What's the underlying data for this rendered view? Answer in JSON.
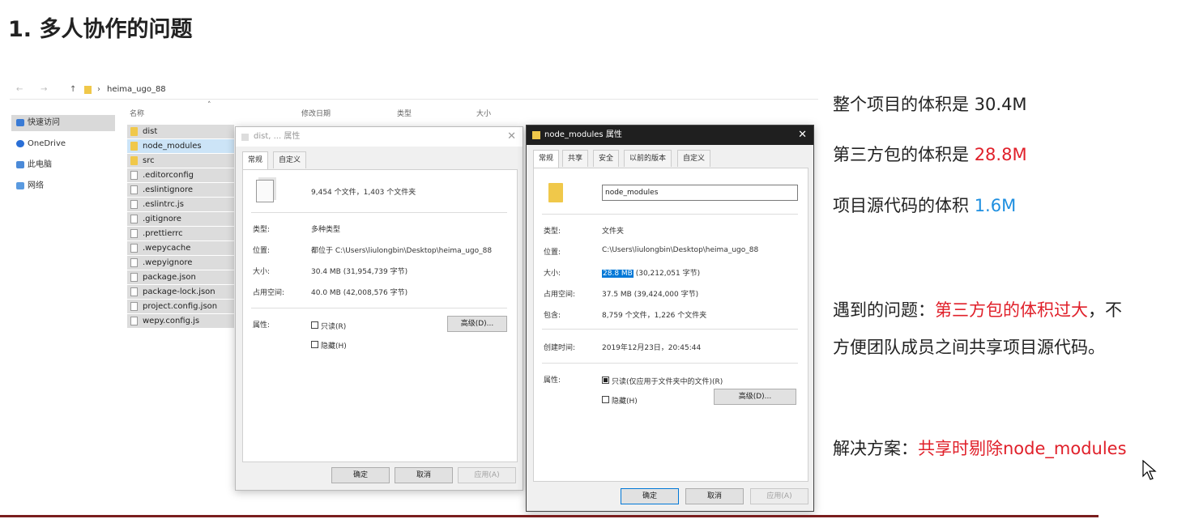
{
  "slide": {
    "title": "1. 多人协作的问题"
  },
  "explorer": {
    "path": "heima_ugo_88",
    "columns": {
      "name": "名称",
      "modified": "修改日期",
      "type": "类型",
      "size": "大小"
    },
    "nav_items": [
      "快速访问",
      "OneDrive",
      "此电脑",
      "网络"
    ],
    "files": [
      {
        "name": "dist",
        "kind": "folder"
      },
      {
        "name": "node_modules",
        "kind": "folder"
      },
      {
        "name": "src",
        "kind": "folder"
      },
      {
        "name": ".editorconfig",
        "kind": "file"
      },
      {
        "name": ".eslintignore",
        "kind": "file"
      },
      {
        "name": ".eslintrc.js",
        "kind": "file"
      },
      {
        "name": ".gitignore",
        "kind": "file"
      },
      {
        "name": ".prettierrc",
        "kind": "file"
      },
      {
        "name": ".wepycache",
        "kind": "file"
      },
      {
        "name": ".wepyignore",
        "kind": "file"
      },
      {
        "name": "package.json",
        "kind": "file"
      },
      {
        "name": "package-lock.json",
        "kind": "file"
      },
      {
        "name": "project.config.json",
        "kind": "file"
      },
      {
        "name": "wepy.config.js",
        "kind": "file"
      }
    ]
  },
  "dialog_dist": {
    "title": "dist, ... 属性",
    "tabs": [
      "常规",
      "自定义"
    ],
    "summary": "9,454 个文件，1,403 个文件夹",
    "type_label": "类型:",
    "type_value": "多种类型",
    "location_label": "位置:",
    "location_value": "都位于 C:\\Users\\liulongbin\\Desktop\\heima_ugo_88",
    "size_label": "大小:",
    "size_value": "30.4 MB (31,954,739 字节)",
    "disk_label": "占用空间:",
    "disk_value": "40.0 MB (42,008,576 字节)",
    "attr_label": "属性:",
    "readonly": "只读(R)",
    "hidden": "隐藏(H)",
    "advanced": "高级(D)...",
    "ok": "确定",
    "cancel": "取消",
    "apply": "应用(A)"
  },
  "dialog_nm": {
    "title": "node_modules 属性",
    "tabs": [
      "常规",
      "共享",
      "安全",
      "以前的版本",
      "自定义"
    ],
    "name_value": "node_modules",
    "type_label": "类型:",
    "type_value": "文件夹",
    "location_label": "位置:",
    "location_value": "C:\\Users\\liulongbin\\Desktop\\heima_ugo_88",
    "size_label": "大小:",
    "size_highlight": "28.8 MB",
    "size_rest": "(30,212,051 字节)",
    "disk_label": "占用空间:",
    "disk_value": "37.5 MB (39,424,000 字节)",
    "contains_label": "包含:",
    "contains_value": "8,759 个文件，1,226 个文件夹",
    "created_label": "创建时间:",
    "created_value": "2019年12月23日，20:45:44",
    "attr_label": "属性:",
    "readonly": "只读(仅应用于文件夹中的文件)(R)",
    "hidden": "隐藏(H)",
    "advanced": "高级(D)...",
    "ok": "确定",
    "cancel": "取消",
    "apply": "应用(A)"
  },
  "notes": {
    "line1": "整个项目的体积是 30.4M",
    "line2_prefix": "第三方包的体积是 ",
    "line2_value": "28.8M",
    "line3_prefix": "项目源代码的体积 ",
    "line3_value": "1.6M",
    "problem_prefix": "遇到的问题：",
    "problem_red": "第三方包的体积过大",
    "problem_rest": "，不",
    "problem_line2": "方便团队成员之间共享项目源代码。",
    "solution_prefix": "解决方案：",
    "solution_red": "共享时剔除node_modules"
  },
  "colors": {
    "accent_red": "#e0202a",
    "accent_blue": "#1e8fe0",
    "selection": "#0078d7"
  }
}
